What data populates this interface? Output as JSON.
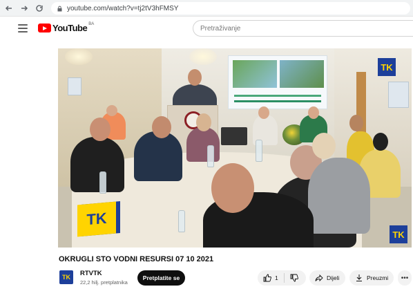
{
  "browser": {
    "url": "youtube.com/watch?v=tj2tV3hFMSY"
  },
  "header": {
    "logo_text": "YouTube",
    "region": "BA",
    "search_placeholder": "Pretraživanje"
  },
  "video": {
    "watermark": "TK",
    "title": "OKRUGLI STO VODNI RESURSI 07 10 2021"
  },
  "channel": {
    "logo_text": "TK",
    "name": "RTVTK",
    "subscribers": "22,2 hilj. pretplatnika",
    "subscribe_label": "Pretplatite se"
  },
  "actions": {
    "like_count": "1",
    "share_label": "Dijeli",
    "save_label": "Preuzmi",
    "more_label": "•••"
  },
  "colors": {
    "youtube_red": "#ff0000",
    "tk_blue": "#1d3f9a",
    "tk_yellow": "#ffd400"
  }
}
